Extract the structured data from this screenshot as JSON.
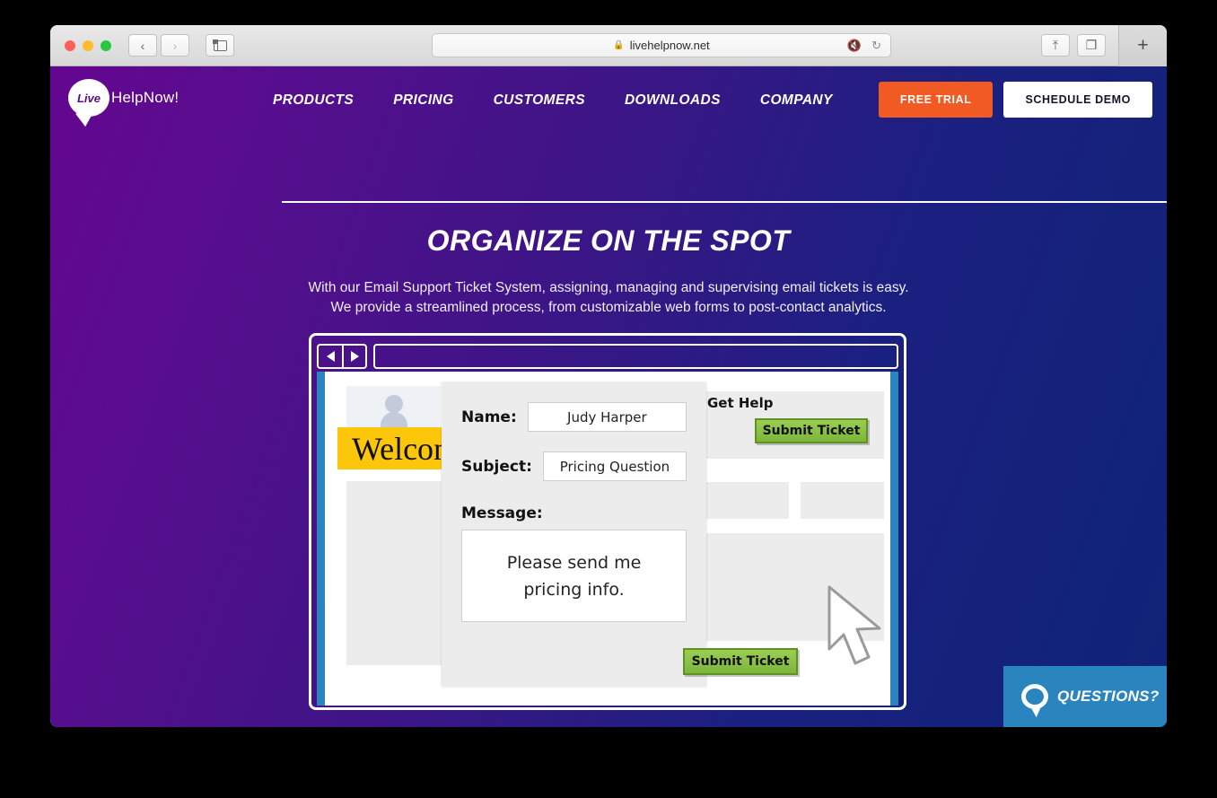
{
  "browser": {
    "url": "livehelpnow.net",
    "lock_icon": "lock-icon",
    "mute_icon": "mute-icon",
    "reload_icon": "reload-icon",
    "back_glyph": "‹",
    "forward_glyph": "›",
    "sidebar_icon": "sidebar-icon",
    "share_icon": "⇧",
    "tabs_icon": "tabs-icon",
    "new_tab_glyph": "+"
  },
  "site": {
    "logo": {
      "bubble_text": "Live",
      "word": "HelpNow!"
    },
    "nav": [
      {
        "label": "PRODUCTS"
      },
      {
        "label": "PRICING"
      },
      {
        "label": "CUSTOMERS"
      },
      {
        "label": "DOWNLOADS"
      },
      {
        "label": "COMPANY"
      }
    ],
    "cta": {
      "free_trial": "FREE TRIAL",
      "schedule_demo": "SCHEDULE DEMO"
    },
    "hero": {
      "title": "ORGANIZE ON THE SPOT",
      "line1": "With our Email Support Ticket System, assigning, managing and supervising email tickets is easy.",
      "line2": "We provide a streamlined process, from customizable web forms to post-contact analytics."
    },
    "chat_widget": {
      "label": "QUESTIONS?",
      "icon": "chat-bubble-icon"
    }
  },
  "mockup": {
    "url_value": "",
    "back_arrow": "back-arrow-icon",
    "forward_arrow": "forward-arrow-icon",
    "welcome_banner": "Welcome",
    "get_help_title": "Get Help",
    "get_help_button": "Submit Ticket",
    "form": {
      "name_label": "Name:",
      "name_value": "Judy Harper",
      "subject_label": "Subject:",
      "subject_value": "Pricing Question",
      "message_label": "Message:",
      "message_line1": "Please send me",
      "message_line2": "pricing info.",
      "submit_label": "Submit Ticket"
    },
    "cursor_icon": "mouse-cursor-icon"
  },
  "colors": {
    "brand_purple": "#5b0b8a",
    "brand_navy": "#0e2477",
    "accent_orange": "#f15a22",
    "banner_yellow": "#fcc60a",
    "submit_green": "#7cb53a",
    "widget_blue": "#2a84bd"
  }
}
